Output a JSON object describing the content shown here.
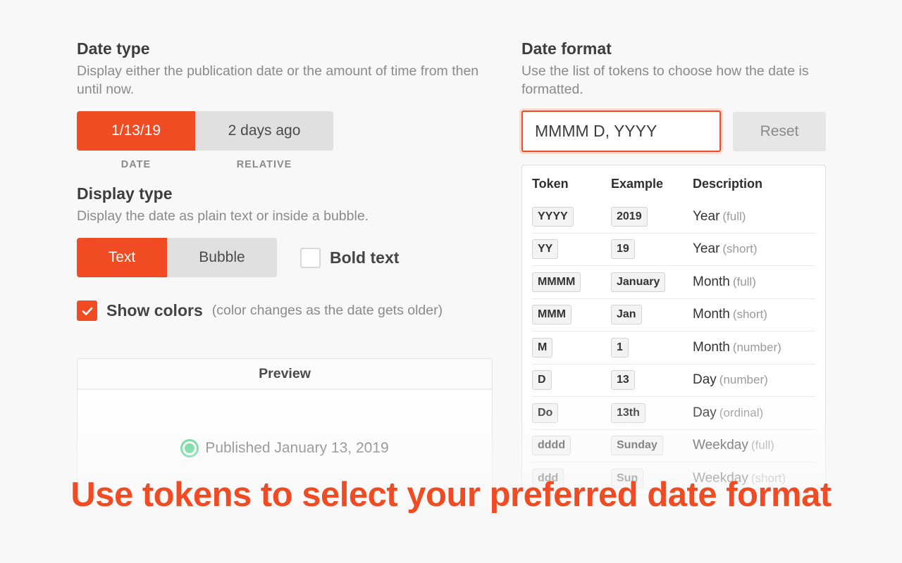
{
  "date_type": {
    "title": "Date type",
    "description": "Display either the publication date or the amount of time from then until now.",
    "options": [
      {
        "value": "1/13/19",
        "label": "DATE",
        "active": true
      },
      {
        "value": "2 days ago",
        "label": "RELATIVE",
        "active": false
      }
    ]
  },
  "display_type": {
    "title": "Display type",
    "description": "Display the date as plain text or inside a bubble.",
    "options": [
      {
        "label": "Text",
        "active": true
      },
      {
        "label": "Bubble",
        "active": false
      }
    ],
    "bold_text": {
      "label": "Bold text",
      "checked": false
    }
  },
  "show_colors": {
    "label": "Show colors",
    "note": "(color changes as the date gets older)",
    "checked": true
  },
  "preview": {
    "title": "Preview",
    "text": "Published January 13, 2019",
    "status_color": "#2ecc71"
  },
  "date_format": {
    "title": "Date format",
    "description": "Use the list of tokens to choose how the date is formatted.",
    "input_value": "MMMM D, YYYY",
    "reset_label": "Reset"
  },
  "token_table": {
    "headers": [
      "Token",
      "Example",
      "Description"
    ],
    "rows": [
      {
        "token": "YYYY",
        "example": "2019",
        "desc": "Year",
        "note": "(full)"
      },
      {
        "token": "YY",
        "example": "19",
        "desc": "Year",
        "note": "(short)"
      },
      {
        "token": "MMMM",
        "example": "January",
        "desc": "Month",
        "note": "(full)"
      },
      {
        "token": "MMM",
        "example": "Jan",
        "desc": "Month",
        "note": "(short)"
      },
      {
        "token": "M",
        "example": "1",
        "desc": "Month",
        "note": "(number)"
      },
      {
        "token": "D",
        "example": "13",
        "desc": "Day",
        "note": "(number)"
      },
      {
        "token": "Do",
        "example": "13th",
        "desc": "Day",
        "note": "(ordinal)"
      },
      {
        "token": "dddd",
        "example": "Sunday",
        "desc": "Weekday",
        "note": "(full)"
      },
      {
        "token": "ddd",
        "example": "Sun",
        "desc": "Weekday",
        "note": "(short)"
      }
    ]
  },
  "caption": "Use tokens to select your preferred date format",
  "colors": {
    "accent": "#f04b23",
    "background": "#f8f8f8"
  }
}
